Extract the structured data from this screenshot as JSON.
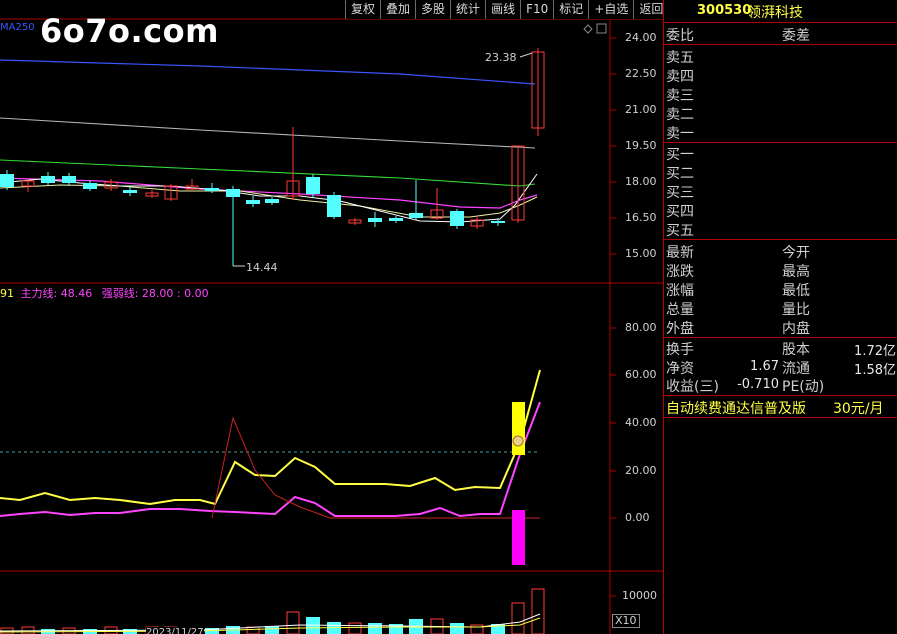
{
  "toolbar": [
    "复权",
    "叠加",
    "多股",
    "统计",
    "画线",
    "F10",
    "标记",
    "+自选",
    "返回"
  ],
  "watermark": "6o7o.com",
  "ma_label": "MA250",
  "price_axis": [
    "24.00",
    "22.50",
    "21.00",
    "19.50",
    "18.00",
    "16.50",
    "15.00"
  ],
  "annotations": {
    "high": "23.38",
    "low": "14.44"
  },
  "indicator": {
    "prefix": "91",
    "main_line": "主力线: 48.46",
    "strength_line": "强弱线: 28.00 : 0.00",
    "axis": [
      "80.00",
      "60.00",
      "40.00",
      "20.00",
      "0.00"
    ]
  },
  "volume": {
    "axis_value": "10000",
    "unit": "X10",
    "date_fragment": "2023/11/27"
  },
  "colors": {
    "up": "#ff3b3b",
    "down": "#54ffff",
    "grid": "#b00000",
    "ma_yellow": "#ffff44",
    "ma_magenta": "#ff44ff",
    "ma_green": "#33dd33",
    "ma_blue": "#3a55ff",
    "ma_grey": "#b4b4b4"
  },
  "stock": {
    "code": "300530",
    "name": "领湃科技"
  },
  "order_book": {
    "ratio_label": "委比",
    "diff_label": "委差",
    "sell": [
      "卖五",
      "卖四",
      "卖三",
      "卖二",
      "卖一"
    ],
    "buy": [
      "买一",
      "买二",
      "买三",
      "买四",
      "买五"
    ]
  },
  "quote": {
    "latest": "最新",
    "open": "今开",
    "change": "涨跌",
    "high": "最高",
    "pct": "涨幅",
    "low": "最低",
    "volume": "总量",
    "vol_ratio": "量比",
    "outer": "外盘",
    "inner": "内盘"
  },
  "fundamentals": {
    "turnover": "换手",
    "share_capital": "股本",
    "share_capital_value": "1.72亿",
    "net_assets": "净资",
    "net_assets_value": "1.67",
    "float": "流通",
    "float_value": "1.58亿",
    "eps": "收益(三)",
    "eps_value": "-0.710",
    "pe": "PE(动)"
  },
  "ad": {
    "text": "自动续费通达信普及版",
    "price": "30元/月"
  }
}
